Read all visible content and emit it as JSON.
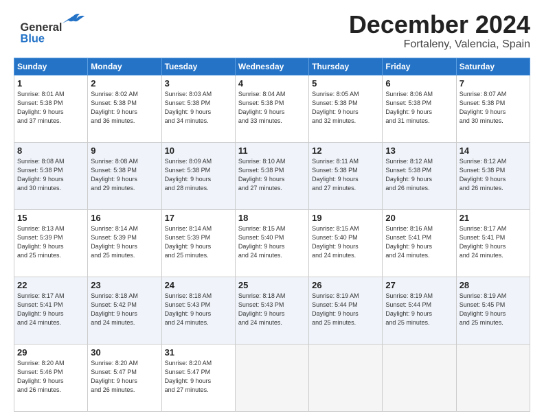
{
  "header": {
    "logo_line1": "General",
    "logo_line2": "Blue",
    "month": "December 2024",
    "location": "Fortaleny, Valencia, Spain"
  },
  "weekdays": [
    "Sunday",
    "Monday",
    "Tuesday",
    "Wednesday",
    "Thursday",
    "Friday",
    "Saturday"
  ],
  "weeks": [
    [
      {
        "day": "1",
        "info": "Sunrise: 8:01 AM\nSunset: 5:38 PM\nDaylight: 9 hours\nand 37 minutes."
      },
      {
        "day": "2",
        "info": "Sunrise: 8:02 AM\nSunset: 5:38 PM\nDaylight: 9 hours\nand 36 minutes."
      },
      {
        "day": "3",
        "info": "Sunrise: 8:03 AM\nSunset: 5:38 PM\nDaylight: 9 hours\nand 34 minutes."
      },
      {
        "day": "4",
        "info": "Sunrise: 8:04 AM\nSunset: 5:38 PM\nDaylight: 9 hours\nand 33 minutes."
      },
      {
        "day": "5",
        "info": "Sunrise: 8:05 AM\nSunset: 5:38 PM\nDaylight: 9 hours\nand 32 minutes."
      },
      {
        "day": "6",
        "info": "Sunrise: 8:06 AM\nSunset: 5:38 PM\nDaylight: 9 hours\nand 31 minutes."
      },
      {
        "day": "7",
        "info": "Sunrise: 8:07 AM\nSunset: 5:38 PM\nDaylight: 9 hours\nand 30 minutes."
      }
    ],
    [
      {
        "day": "8",
        "info": "Sunrise: 8:08 AM\nSunset: 5:38 PM\nDaylight: 9 hours\nand 30 minutes."
      },
      {
        "day": "9",
        "info": "Sunrise: 8:08 AM\nSunset: 5:38 PM\nDaylight: 9 hours\nand 29 minutes."
      },
      {
        "day": "10",
        "info": "Sunrise: 8:09 AM\nSunset: 5:38 PM\nDaylight: 9 hours\nand 28 minutes."
      },
      {
        "day": "11",
        "info": "Sunrise: 8:10 AM\nSunset: 5:38 PM\nDaylight: 9 hours\nand 27 minutes."
      },
      {
        "day": "12",
        "info": "Sunrise: 8:11 AM\nSunset: 5:38 PM\nDaylight: 9 hours\nand 27 minutes."
      },
      {
        "day": "13",
        "info": "Sunrise: 8:12 AM\nSunset: 5:38 PM\nDaylight: 9 hours\nand 26 minutes."
      },
      {
        "day": "14",
        "info": "Sunrise: 8:12 AM\nSunset: 5:38 PM\nDaylight: 9 hours\nand 26 minutes."
      }
    ],
    [
      {
        "day": "15",
        "info": "Sunrise: 8:13 AM\nSunset: 5:39 PM\nDaylight: 9 hours\nand 25 minutes."
      },
      {
        "day": "16",
        "info": "Sunrise: 8:14 AM\nSunset: 5:39 PM\nDaylight: 9 hours\nand 25 minutes."
      },
      {
        "day": "17",
        "info": "Sunrise: 8:14 AM\nSunset: 5:39 PM\nDaylight: 9 hours\nand 25 minutes."
      },
      {
        "day": "18",
        "info": "Sunrise: 8:15 AM\nSunset: 5:40 PM\nDaylight: 9 hours\nand 24 minutes."
      },
      {
        "day": "19",
        "info": "Sunrise: 8:15 AM\nSunset: 5:40 PM\nDaylight: 9 hours\nand 24 minutes."
      },
      {
        "day": "20",
        "info": "Sunrise: 8:16 AM\nSunset: 5:41 PM\nDaylight: 9 hours\nand 24 minutes."
      },
      {
        "day": "21",
        "info": "Sunrise: 8:17 AM\nSunset: 5:41 PM\nDaylight: 9 hours\nand 24 minutes."
      }
    ],
    [
      {
        "day": "22",
        "info": "Sunrise: 8:17 AM\nSunset: 5:41 PM\nDaylight: 9 hours\nand 24 minutes."
      },
      {
        "day": "23",
        "info": "Sunrise: 8:18 AM\nSunset: 5:42 PM\nDaylight: 9 hours\nand 24 minutes."
      },
      {
        "day": "24",
        "info": "Sunrise: 8:18 AM\nSunset: 5:43 PM\nDaylight: 9 hours\nand 24 minutes."
      },
      {
        "day": "25",
        "info": "Sunrise: 8:18 AM\nSunset: 5:43 PM\nDaylight: 9 hours\nand 24 minutes."
      },
      {
        "day": "26",
        "info": "Sunrise: 8:19 AM\nSunset: 5:44 PM\nDaylight: 9 hours\nand 25 minutes."
      },
      {
        "day": "27",
        "info": "Sunrise: 8:19 AM\nSunset: 5:44 PM\nDaylight: 9 hours\nand 25 minutes."
      },
      {
        "day": "28",
        "info": "Sunrise: 8:19 AM\nSunset: 5:45 PM\nDaylight: 9 hours\nand 25 minutes."
      }
    ],
    [
      {
        "day": "29",
        "info": "Sunrise: 8:20 AM\nSunset: 5:46 PM\nDaylight: 9 hours\nand 26 minutes."
      },
      {
        "day": "30",
        "info": "Sunrise: 8:20 AM\nSunset: 5:47 PM\nDaylight: 9 hours\nand 26 minutes."
      },
      {
        "day": "31",
        "info": "Sunrise: 8:20 AM\nSunset: 5:47 PM\nDaylight: 9 hours\nand 27 minutes."
      },
      {
        "day": "",
        "info": ""
      },
      {
        "day": "",
        "info": ""
      },
      {
        "day": "",
        "info": ""
      },
      {
        "day": "",
        "info": ""
      }
    ]
  ]
}
